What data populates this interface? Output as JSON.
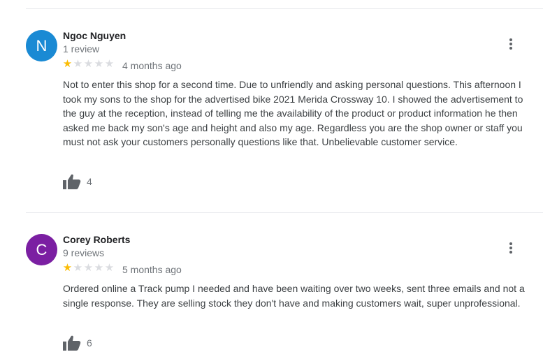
{
  "reviews": [
    {
      "initial": "N",
      "avatar_color": "#1a8ad4",
      "name": "Ngoc Nguyen",
      "review_count": "1 review",
      "rating": 1,
      "date": "4 months ago",
      "text": "Not to enter this shop for a second time. Due to unfriendly and asking personal questions. This afternoon I took my sons to the shop for the advertised bike 2021 Merida Crossway 10. I showed the advertisement to the guy at the reception, instead of telling me the availability of the product or product information he then asked me back my son's age and height and also my age. Regardless you are the shop owner or staff you must not ask your customers personally questions like that. Unbelievable customer service.",
      "likes": "4"
    },
    {
      "initial": "C",
      "avatar_color": "#7b1fa2",
      "name": "Corey Roberts",
      "review_count": "9 reviews",
      "rating": 1,
      "date": "5 months ago",
      "text": "Ordered online a Track pump I needed and have been waiting over two weeks, sent three emails and not a single response.  They are selling stock they don't have and making customers wait, super unprofessional.",
      "likes": "6"
    }
  ],
  "icons": {
    "menu": "more-vert-icon",
    "like": "thumb-up-icon",
    "star": "star-icon"
  }
}
